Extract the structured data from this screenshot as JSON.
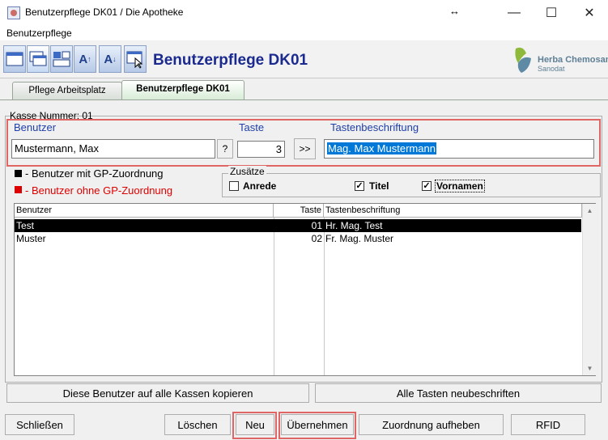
{
  "window": {
    "title": "Benutzerpflege DK01 / Die Apotheke"
  },
  "menu": {
    "item": "Benutzerpflege"
  },
  "toolbar": {
    "title": "Benutzerpflege DK01",
    "logo_name": "Herba Chemosan",
    "logo_sub": "Sanodat",
    "icons": [
      "window-cascade-icon",
      "window-tile-icon",
      "window-grid-icon",
      "font-increase-icon",
      "font-decrease-icon",
      "exit-icon"
    ]
  },
  "tabs": [
    {
      "label": "Pflege Arbeitsplatz",
      "active": false
    },
    {
      "label": "Benutzerpflege DK01",
      "active": true
    }
  ],
  "kasse": {
    "label": "Kasse Nummer: 01"
  },
  "form": {
    "benutzer_label": "Benutzer",
    "benutzer_value": "Mustermann, Max",
    "lookup_button": "?",
    "taste_label": "Taste",
    "taste_value": "3",
    "transfer_button": ">>",
    "tasten_label": "Tastenbeschriftung",
    "tasten_value": "Mag. Max Mustermann"
  },
  "legend": {
    "with_gp": "- Benutzer mit GP-Zuordnung",
    "without_gp": "- Benutzer ohne GP-Zuordnung"
  },
  "zusaetze": {
    "label": "Zusätze",
    "options": [
      {
        "label": "Anrede",
        "checked": false
      },
      {
        "label": "Titel",
        "checked": true
      },
      {
        "label": "Vornamen",
        "checked": true
      }
    ]
  },
  "table": {
    "columns": [
      "Benutzer",
      "Taste",
      "Tastenbeschriftung"
    ],
    "rows": [
      {
        "benutzer": "Test",
        "taste": "01",
        "beschriftung": "Hr. Mag. Test",
        "selected": true
      },
      {
        "benutzer": "Muster",
        "taste": "02",
        "beschriftung": "Fr. Mag. Muster",
        "selected": false
      }
    ]
  },
  "actions": {
    "copy_all": "Diese Benutzer auf alle Kassen kopieren",
    "relabel_all": "Alle Tasten neubeschriften",
    "close": "Schließen",
    "delete": "Löschen",
    "new": "Neu",
    "apply": "Übernehmen",
    "unassign": "Zuordnung aufheben",
    "rfid": "RFID"
  },
  "colors": {
    "accent_title": "#1b2a8e",
    "label_blue": "#1f3fa8",
    "highlight_red": "#e06666",
    "selected_row": "#000000",
    "legend_red": "#dd0000"
  }
}
